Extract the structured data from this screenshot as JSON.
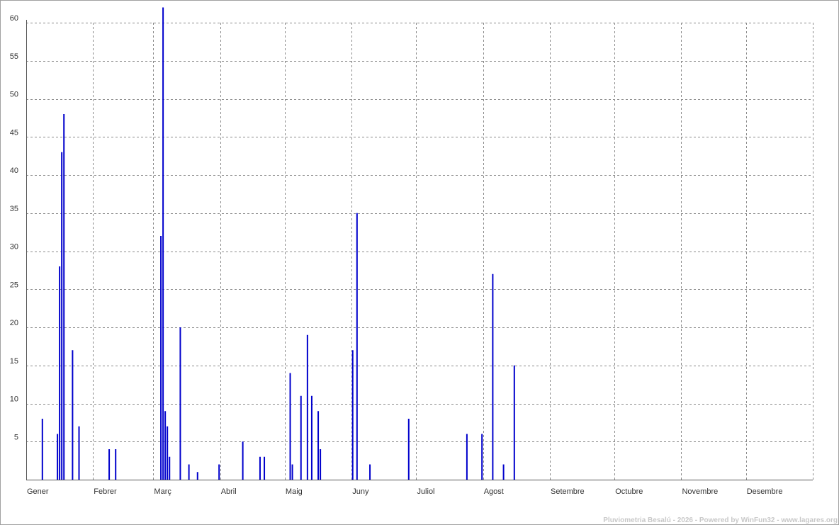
{
  "chart_data": {
    "type": "bar",
    "title": "",
    "xlabel": "",
    "ylabel": "",
    "ylim": [
      0,
      60
    ],
    "y_ticks": [
      "5",
      "10",
      "15",
      "20",
      "25",
      "30",
      "35",
      "40",
      "45",
      "50",
      "55",
      "60"
    ],
    "x_ticks": [
      "Gener",
      "Febrer",
      "Març",
      "Abril",
      "Maig",
      "Juny",
      "Juliol",
      "Agost",
      "Setembre",
      "Octubre",
      "Novembre",
      "Desembre"
    ],
    "grid": true,
    "bar_color": "#0000cc",
    "x_unit": "day of year",
    "points": [
      {
        "x": 8,
        "y": 8
      },
      {
        "x": 15,
        "y": 6
      },
      {
        "x": 16,
        "y": 28
      },
      {
        "x": 17,
        "y": 43
      },
      {
        "x": 18,
        "y": 48
      },
      {
        "x": 22,
        "y": 17
      },
      {
        "x": 25,
        "y": 7
      },
      {
        "x": 39,
        "y": 4
      },
      {
        "x": 42,
        "y": 4
      },
      {
        "x": 63,
        "y": 32
      },
      {
        "x": 64,
        "y": 62
      },
      {
        "x": 65,
        "y": 9
      },
      {
        "x": 66,
        "y": 7
      },
      {
        "x": 67,
        "y": 3
      },
      {
        "x": 72,
        "y": 20
      },
      {
        "x": 76,
        "y": 2
      },
      {
        "x": 80,
        "y": 1
      },
      {
        "x": 90,
        "y": 2
      },
      {
        "x": 101,
        "y": 5
      },
      {
        "x": 109,
        "y": 3
      },
      {
        "x": 111,
        "y": 3
      },
      {
        "x": 123,
        "y": 14
      },
      {
        "x": 124,
        "y": 2
      },
      {
        "x": 128,
        "y": 11
      },
      {
        "x": 131,
        "y": 19
      },
      {
        "x": 133,
        "y": 11
      },
      {
        "x": 136,
        "y": 9
      },
      {
        "x": 137,
        "y": 4
      },
      {
        "x": 152,
        "y": 17
      },
      {
        "x": 154,
        "y": 35
      },
      {
        "x": 160,
        "y": 2
      },
      {
        "x": 178,
        "y": 8
      },
      {
        "x": 205,
        "y": 6
      },
      {
        "x": 212,
        "y": 6
      },
      {
        "x": 217,
        "y": 27
      },
      {
        "x": 222,
        "y": 2
      },
      {
        "x": 227,
        "y": 15
      }
    ]
  },
  "footer": {
    "credit": "Pluviometria Besalú - 2026 - Powered by WinFun32 - www.lagares.org"
  }
}
